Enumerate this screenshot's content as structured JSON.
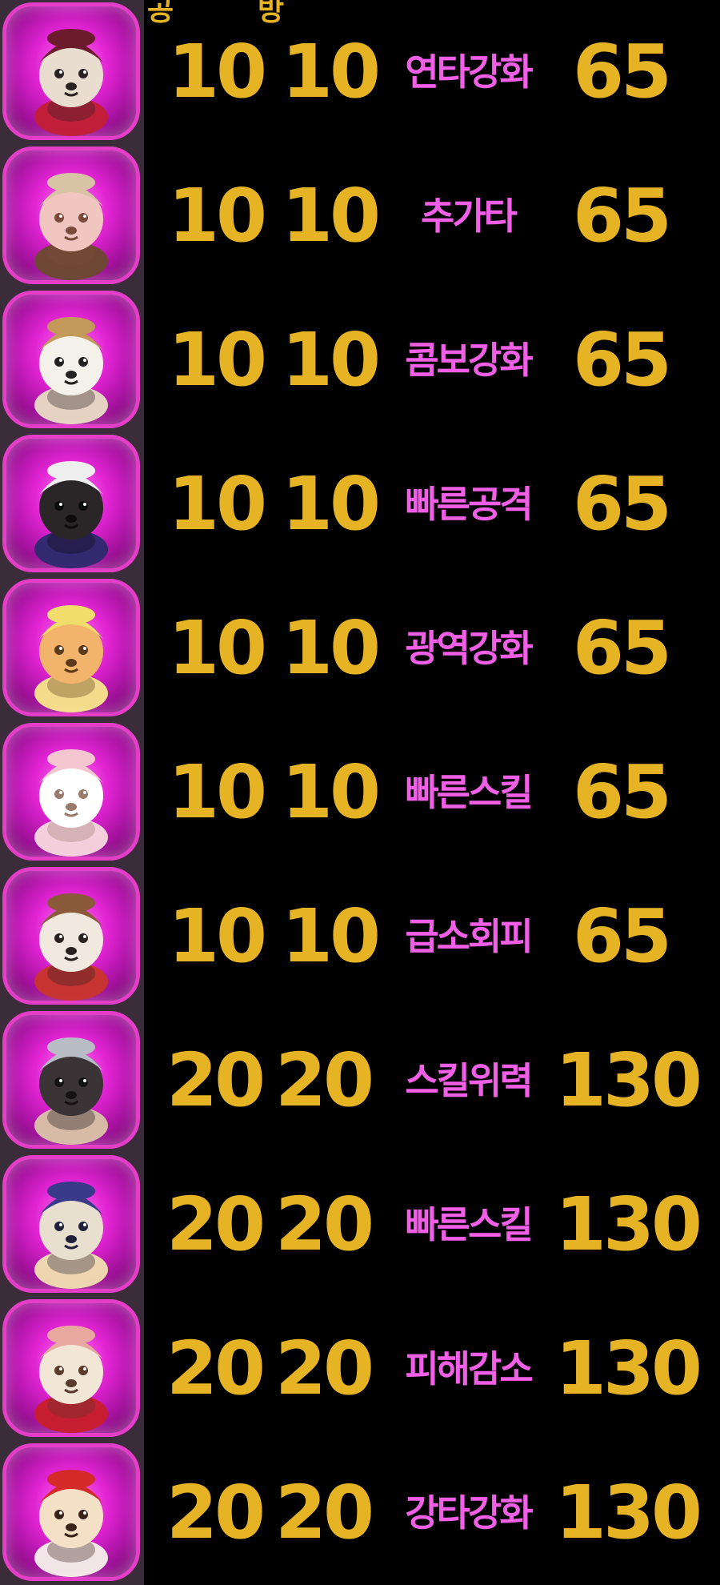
{
  "header": {
    "attack_label": "공",
    "defense_label": "방"
  },
  "rows": [
    {
      "icon": "cat-gentleman-top-hat-icon",
      "attack": "10",
      "defense": "10",
      "skill": "연타강화",
      "cost": "65"
    },
    {
      "icon": "dog-detective-pipe-icon",
      "attack": "10",
      "defense": "10",
      "skill": "추가타",
      "cost": "65"
    },
    {
      "icon": "polar-bear-laurel-icon",
      "attack": "10",
      "defense": "10",
      "skill": "콤보강화",
      "cost": "65"
    },
    {
      "icon": "black-cat-witch-hat-icon",
      "attack": "10",
      "defense": "10",
      "skill": "빠른공격",
      "cost": "65"
    },
    {
      "icon": "shiba-yellow-raincoat-icon",
      "attack": "10",
      "defense": "10",
      "skill": "광역강화",
      "cost": "65"
    },
    {
      "icon": "rabbit-sheep-costume-icon",
      "attack": "10",
      "defense": "10",
      "skill": "빠른스킬",
      "cost": "65"
    },
    {
      "icon": "raccoon-adventurer-goggles-icon",
      "attack": "10",
      "defense": "10",
      "skill": "급소회피",
      "cost": "65"
    },
    {
      "icon": "wolf-knight-helmet-icon",
      "attack": "20",
      "defense": "20",
      "skill": "스킬위력",
      "cost": "130"
    },
    {
      "icon": "owl-hooded-horns-icon",
      "attack": "20",
      "defense": "20",
      "skill": "빠른스킬",
      "cost": "130"
    },
    {
      "icon": "shihtzu-flower-crown-icon",
      "attack": "20",
      "defense": "20",
      "skill": "피해감소",
      "cost": "130"
    },
    {
      "icon": "hamster-strawberry-hood-icon",
      "attack": "20",
      "defense": "20",
      "skill": "강타강화",
      "cost": "130"
    }
  ]
}
